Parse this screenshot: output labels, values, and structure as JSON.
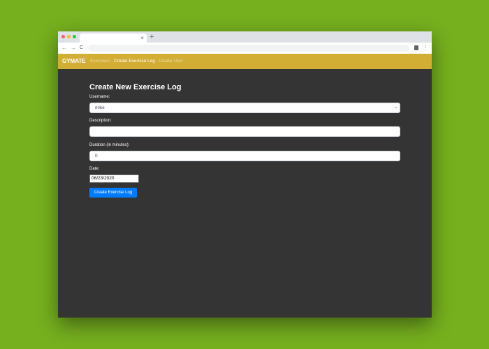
{
  "browser": {
    "tab_title": "",
    "tab_close": "×",
    "new_tab": "+",
    "back": "←",
    "forward": "→",
    "reload": "C",
    "url": "",
    "menu": "⋮"
  },
  "navbar": {
    "brand": "GYMATE",
    "links": [
      {
        "label": "Exercises",
        "active": false
      },
      {
        "label": "Create Exercise Log",
        "active": true
      },
      {
        "label": "Create User",
        "active": false
      }
    ]
  },
  "form": {
    "title": "Create New Exercise Log",
    "username_label": "Username:",
    "username_value": "mike",
    "description_label": "Description:",
    "description_value": "",
    "duration_label": "Duration (in minutes):",
    "duration_value": "0",
    "date_label": "Date:",
    "date_value": "06/23/2020",
    "submit_label": "Create Exercise Log"
  },
  "colors": {
    "page_background": "#76b01f",
    "navbar": "#d2ae34",
    "app_background": "#343434",
    "primary_button": "#007bff"
  }
}
